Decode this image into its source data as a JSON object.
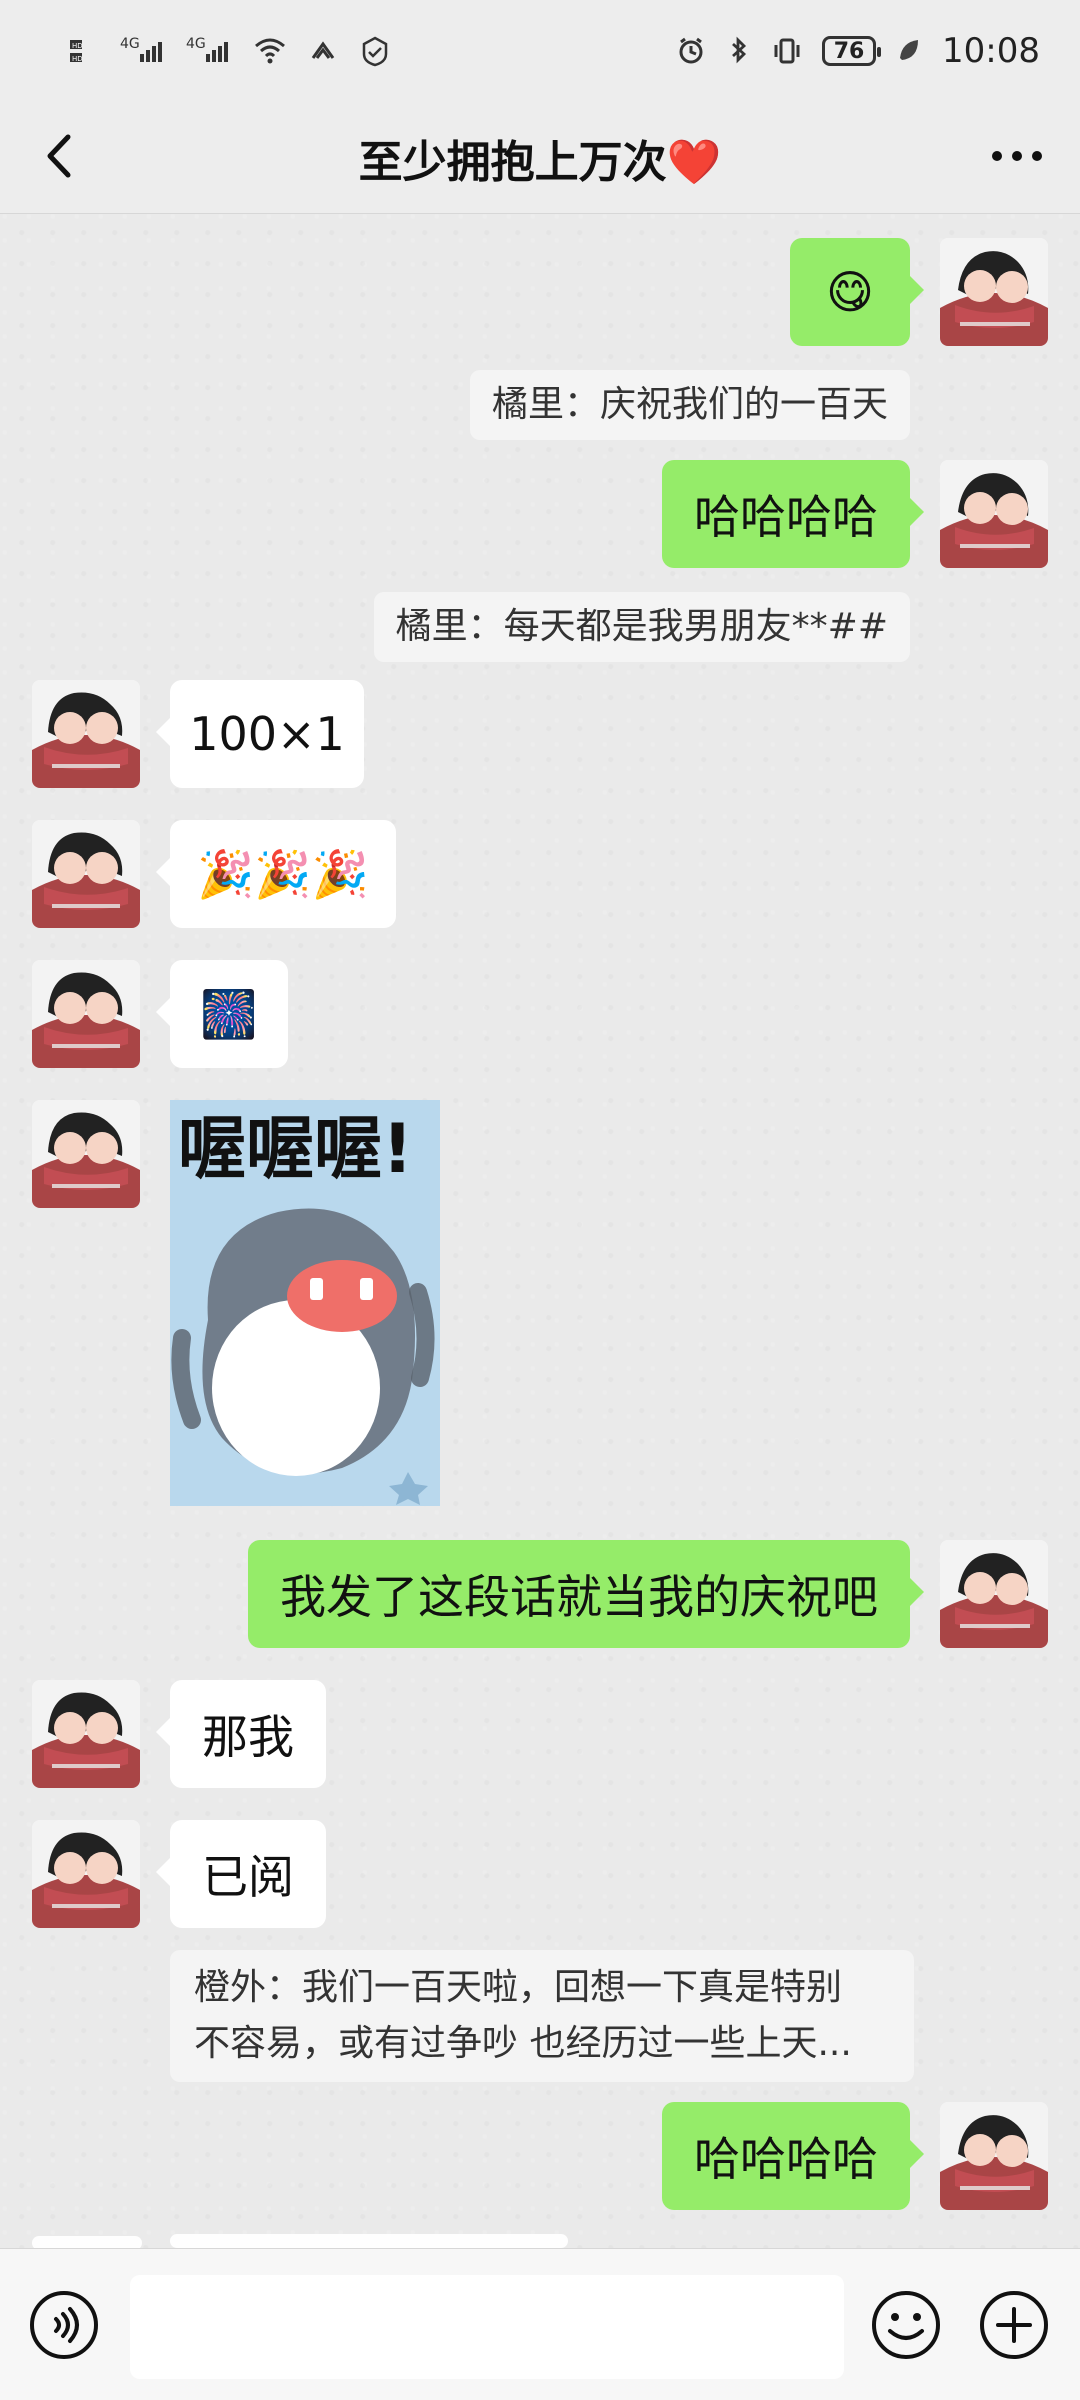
{
  "status_bar": {
    "network_label": "4G",
    "battery": "76",
    "time": "10:08"
  },
  "header": {
    "title": "至少拥抱上万次❤️"
  },
  "messages": [
    {
      "side": "right",
      "text": "😋",
      "quote": "橘里：庆祝我们的一百天"
    },
    {
      "side": "right",
      "text": "哈哈哈哈",
      "quote": "橘里：每天都是我男朋友**##"
    },
    {
      "side": "left",
      "text": "100×1"
    },
    {
      "side": "left",
      "text": "🎉🎉🎉"
    },
    {
      "side": "left",
      "text": "🎆"
    },
    {
      "side": "left",
      "sticker_text": "喔喔喔!"
    },
    {
      "side": "right",
      "text": "我发了这段话就当我的庆祝吧"
    },
    {
      "side": "left",
      "text": "那我"
    },
    {
      "side": "left",
      "text": "已阅",
      "quote_line_1": "橙外：我们一百天啦，回想一下真是特别",
      "quote_line_2": "不容易，或有过争吵 也经历过一些上天..."
    },
    {
      "side": "right",
      "text": "哈哈哈哈"
    }
  ],
  "input": {
    "placeholder": ""
  },
  "colors": {
    "background": "#ededed",
    "sent_bubble": "#95ec69",
    "received_bubble": "#ffffff",
    "quote_bg": "#f4f4f4"
  },
  "icons": {
    "back": "chevron-left-icon",
    "more": "more-dots-icon",
    "voice": "voice-icon",
    "emoji": "emoji-icon",
    "add": "plus-icon"
  }
}
